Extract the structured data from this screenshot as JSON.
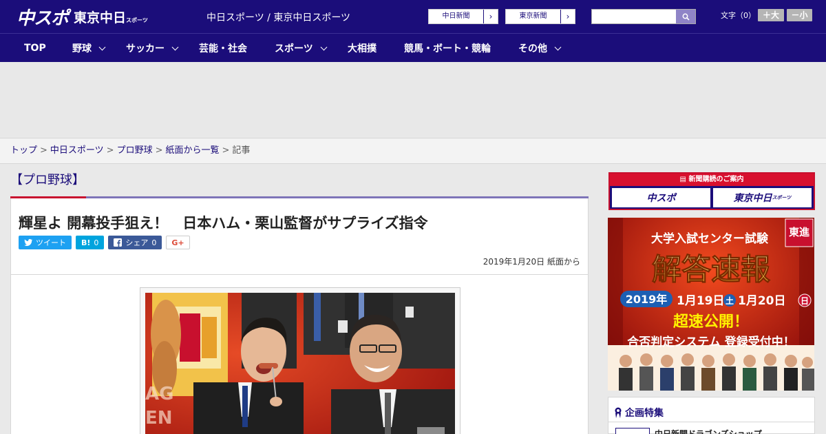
{
  "header": {
    "logo_chu": "中スポ",
    "logo_tokyo": "東京中日",
    "logo_tokyo_small": "スポーツ",
    "site_title": "中日スポーツ / 東京中日スポーツ",
    "paper_buttons": [
      "中日新聞",
      "東京新聞"
    ],
    "search_placeholder": "",
    "font_label": "文字（0）",
    "font_bigger": "＋大",
    "font_smaller": "－小"
  },
  "nav": [
    {
      "label": "TOP",
      "has_dropdown": false
    },
    {
      "label": "野球",
      "has_dropdown": true
    },
    {
      "label": "サッカー",
      "has_dropdown": true
    },
    {
      "label": "芸能・社会",
      "has_dropdown": false
    },
    {
      "label": "スポーツ",
      "has_dropdown": true
    },
    {
      "label": "大相撲",
      "has_dropdown": false
    },
    {
      "label": "競馬・ボート・競輪",
      "has_dropdown": false
    },
    {
      "label": "その他",
      "has_dropdown": true
    }
  ],
  "breadcrumb": {
    "links": [
      "トップ",
      "中日スポーツ",
      "プロ野球",
      "紙面から一覧"
    ],
    "current": "記事",
    "separator": ">"
  },
  "article": {
    "category": "【プロ野球】",
    "headline": "輝星よ 開幕投手狙え！　日本ハム・栗山監督がサプライズ指令",
    "share": {
      "tweet": "ツイート",
      "hatena": "B!",
      "hatena_count": "0",
      "facebook": "シェア",
      "facebook_count": "0",
      "gplus": "G+"
    },
    "date": "2019年1月20日 紙面から"
  },
  "sidebar": {
    "subscription_title": "新聞購読のご案内",
    "subscription_buttons": [
      "中スポ",
      "東京中日"
    ],
    "subscription_small": "スポーツ",
    "banner": {
      "corner_badge": "東進",
      "top_line": "大学入試センター試験",
      "main_line": "解答速報",
      "year": "2019年",
      "date1": "1月19日",
      "day1": "土",
      "date2": "1月20日",
      "day2": "日",
      "release": "超速公開！",
      "signup": "合否判定システム 登録受付中！"
    },
    "feature_title": "企画特集",
    "feature_item": "中日新聞ドラゴンズショップ"
  },
  "colors": {
    "brand": "#1b0d7a",
    "accent_red": "#c8102e",
    "tab_line": "#7e74b8"
  }
}
